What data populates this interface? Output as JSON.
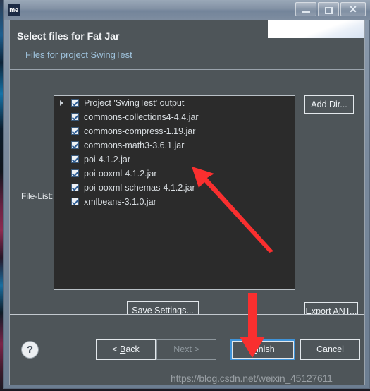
{
  "window": {
    "app_icon_text": "me",
    "controls": {
      "minimize": "minimize-icon",
      "maximize": "maximize-icon",
      "close": "close-icon",
      "close_glyph": "✕"
    }
  },
  "header": {
    "title": "Select files for Fat Jar",
    "subtitle": "Files for project SwingTest"
  },
  "body": {
    "filelist_label": "File-List:",
    "files": [
      {
        "label": "Project 'SwingTest' output",
        "checked": true,
        "expandable": true
      },
      {
        "label": "commons-collections4-4.4.jar",
        "checked": true,
        "expandable": false
      },
      {
        "label": "commons-compress-1.19.jar",
        "checked": true,
        "expandable": false
      },
      {
        "label": "commons-math3-3.6.1.jar",
        "checked": true,
        "expandable": false
      },
      {
        "label": "poi-4.1.2.jar",
        "checked": true,
        "expandable": false
      },
      {
        "label": "poi-ooxml-4.1.2.jar",
        "checked": true,
        "expandable": false
      },
      {
        "label": "poi-ooxml-schemas-4.1.2.jar",
        "checked": true,
        "expandable": false
      },
      {
        "label": "xmlbeans-3.1.0.jar",
        "checked": true,
        "expandable": false
      }
    ],
    "add_dir_label": "Add Dir...",
    "export_ant_label": "Export ANT...",
    "save_settings_label": "Save Settings..."
  },
  "bottom": {
    "help_glyph": "?",
    "back_label": "< Back",
    "back_mnemonic": "B",
    "next_label": "Next >",
    "next_enabled": false,
    "finish_label": "Finish",
    "finish_mnemonic": "F",
    "cancel_label": "Cancel"
  },
  "annotations": {
    "arrow_to_list": "red-arrow-pointing-to-file-list",
    "arrow_to_finish": "red-arrow-pointing-to-finish-button",
    "watermark": "https://blog.csdn.net/weixin_45127611"
  },
  "colors": {
    "dialog_bg": "#4e5559",
    "list_bg": "#2b2b2b",
    "subtitle": "#9fc3dd",
    "focus_ring": "#3f93d8",
    "annotation_red": "#f92f2f",
    "app_icon_bg": "#1b2a44"
  }
}
